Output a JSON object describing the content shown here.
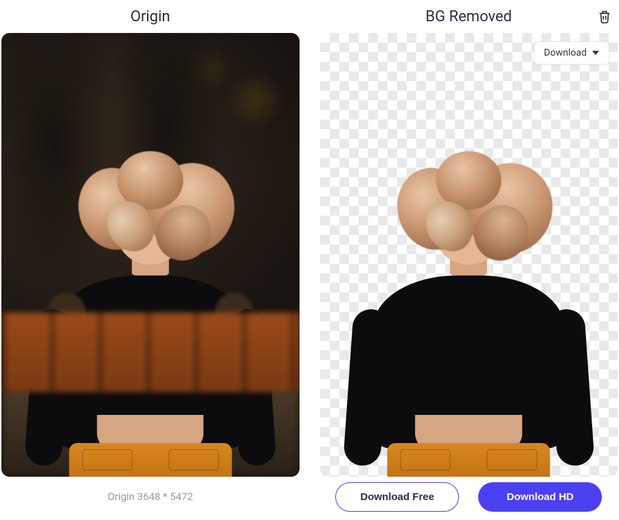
{
  "left": {
    "title": "Origin",
    "caption": "Origin 3648 * 5472"
  },
  "right": {
    "title": "BG Removed",
    "download_dropdown_label": "Download",
    "download_free_label": "Download Free",
    "download_hd_label": "Download HD"
  },
  "icons": {
    "trash": "trash-icon",
    "caret": "caret-down-icon"
  },
  "colors": {
    "accent": "#4b3ff2"
  }
}
